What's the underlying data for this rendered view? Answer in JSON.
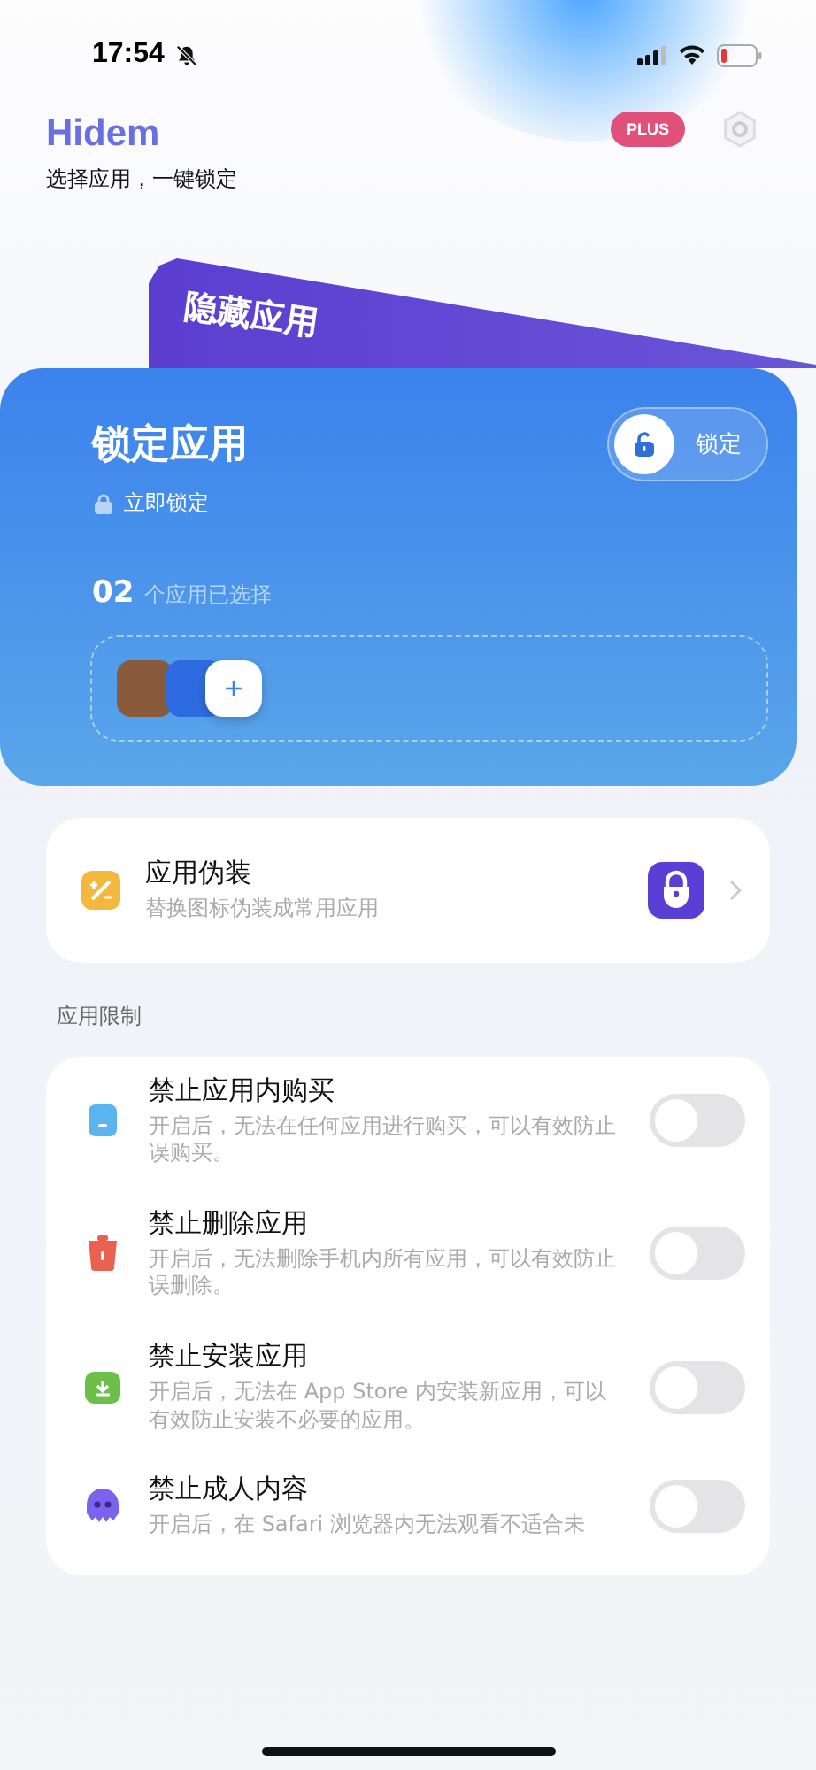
{
  "status_bar": {
    "time": "17:54"
  },
  "header": {
    "title": "Hidem",
    "subtitle": "选择应用，一键锁定",
    "badge": "PLUS"
  },
  "back_card": {
    "title": "隐藏应用"
  },
  "lock_card": {
    "title": "锁定应用",
    "action": "立即锁定",
    "toggle_label": "锁定",
    "count": "02",
    "count_label": "个应用已选择",
    "apps": [
      {
        "kind": "photo"
      },
      {
        "kind": "blue"
      }
    ],
    "add_label": "+"
  },
  "disguise": {
    "title": "应用伪装",
    "subtitle": "替换图标伪装成常用应用"
  },
  "section_label": "应用限制",
  "restrictions": [
    {
      "kind": "purchase",
      "title": "禁止应用内购买",
      "description": "开启后，无法在任何应用进行购买，可以有效防止误购买。",
      "on": false
    },
    {
      "kind": "delete",
      "title": "禁止删除应用",
      "description": "开启后，无法删除手机内所有应用，可以有效防止误删除。",
      "on": false
    },
    {
      "kind": "install",
      "title": "禁止安装应用",
      "description": "开启后，无法在 App Store 内安装新应用，可以有效防止安装不必要的应用。",
      "on": false
    },
    {
      "kind": "adult",
      "title": "禁止成人内容",
      "description": "开启后，在 Safari 浏览器内无法观看不适合未",
      "on": false
    }
  ]
}
